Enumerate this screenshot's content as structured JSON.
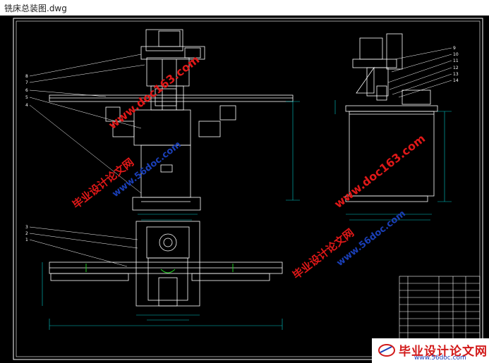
{
  "window": {
    "title": "铣床总装图.dwg"
  },
  "watermarks": {
    "site_cn": "毕业设计论文网",
    "site_url": "www.56doc.com",
    "doc_url": "www.doc163.com"
  },
  "logo": {
    "text": "毕业设计论文网",
    "url": "www.56doc.com"
  },
  "colors": {
    "background": "#000000",
    "frame": "#ffffff",
    "part_lines": "#ffffff",
    "dimension_lines": "#00c8c8",
    "leader_lines": "#ffffff",
    "watermark_red": "#e01818",
    "watermark_blue": "#1a3fb8",
    "accent_green": "#22cc22"
  },
  "callouts": {
    "front_view": [
      "8",
      "7",
      "6",
      "5",
      "4"
    ],
    "side_view": [
      "9",
      "10",
      "11",
      "12",
      "13",
      "14"
    ],
    "top_view": [
      "3",
      "2",
      "1"
    ]
  }
}
